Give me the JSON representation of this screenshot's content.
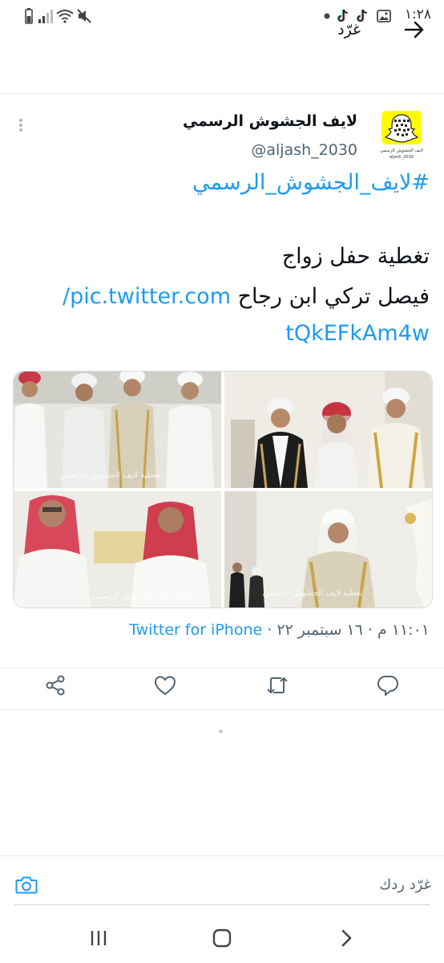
{
  "status_bar": {
    "time": "١:٢٨"
  },
  "header": {
    "title": "غرّد"
  },
  "tweet": {
    "display_name": "لايف الجشوش الرسمي",
    "handle": "@aljash_2030",
    "avatar_caption": "لايف الجشوش الرسمي",
    "avatar_handle": "aljash_2030",
    "hashtag": "#لايف_الجشوش_الرسمي",
    "line1": "تغطية حفل زواج",
    "line2_text": "فيصل تركي ابن رجاح ",
    "line2_link": "pic.twitter.com/",
    "line3_link": "tQkEFkAm4w",
    "watermark": "تغطية لايف الجشوش الرسمي",
    "timestamp": "١١:٠١ م · ١٦ سبتمبر ٢٢ · ",
    "source": "Twitter for iPhone"
  },
  "reply": {
    "placeholder": "غرّد ردك"
  },
  "colors": {
    "accent": "#1d9bf0",
    "text": "#0f1419",
    "secondary": "#536471",
    "snapchat_yellow": "#fffc00"
  },
  "icons": {
    "header": "arrow-right-icon",
    "actions": [
      "share-icon",
      "like-icon",
      "retweet-icon",
      "reply-icon"
    ],
    "nav": [
      "recent-apps-icon",
      "home-icon",
      "back-icon"
    ]
  }
}
